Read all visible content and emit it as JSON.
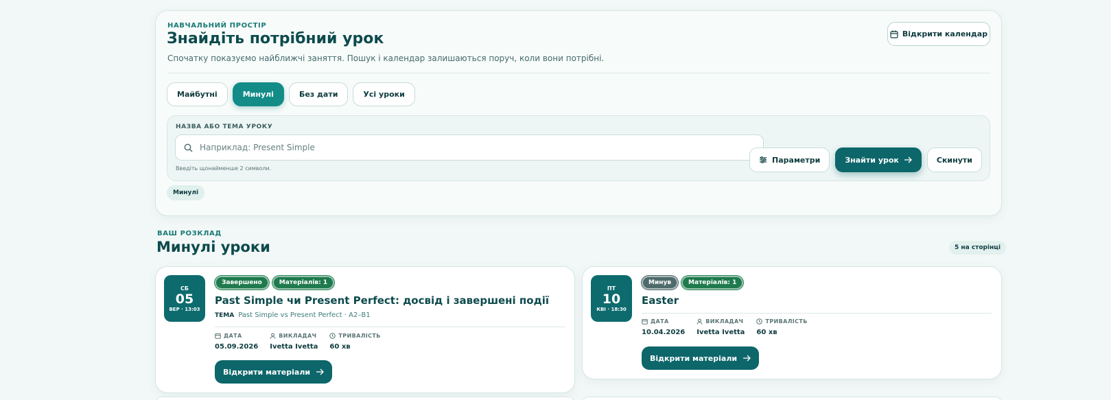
{
  "header": {
    "eyebrow": "НАВЧАЛЬНИЙ ПРОСТІР",
    "title": "Знайдіть потрібний урок",
    "description": "Спочатку показуємо найближчі заняття. Пошук і календар залишаються поруч, коли вони потрібні.",
    "calendar_button": "Відкрити календар"
  },
  "tabs": [
    {
      "label": "Майбутні",
      "active": false
    },
    {
      "label": "Минулі",
      "active": true
    },
    {
      "label": "Без дати",
      "active": false
    },
    {
      "label": "Усі уроки",
      "active": false
    }
  ],
  "search": {
    "label": "НАЗВА АБО ТЕМА УРОКУ",
    "placeholder": "Наприклад: Present Simple",
    "value": "",
    "hint": "Введіть щонайменше 2 символи.",
    "params_button": "Параметри",
    "find_button": "Знайти урок",
    "reset_button": "Скинути"
  },
  "active_filter": "Минулі",
  "section": {
    "eyebrow": "ВАШ РОЗКЛАД",
    "title": "Минулі уроки",
    "per_page": "5 на сторінці"
  },
  "meta_labels": {
    "date": "ДАТА",
    "teacher": "ВИКЛАДАЧ",
    "duration": "ТРИВАЛІСТЬ",
    "topic": "ТЕМА"
  },
  "lessons": [
    {
      "dow": "СБ",
      "day": "05",
      "sub": "ВЕР · 13:03",
      "status": "Завершено",
      "materials": "Матеріалів: 1",
      "title": "Past Simple чи Present Perfect: досвід і завершені події",
      "topic": "Past Simple vs Present Perfect · A2–B1",
      "date": "05.09.2026",
      "teacher": "Ivetta Ivetta",
      "duration": "60 хв",
      "open_button": "Відкрити матеріали"
    },
    {
      "dow": "ПТ",
      "day": "10",
      "sub": "КВІ · 18:30",
      "status": "Минув",
      "materials": "Матеріалів: 1",
      "title": "Easter",
      "date": "10.04.2026",
      "teacher": "Ivetta Ivetta",
      "duration": "60 хв",
      "open_button": "Відкрити матеріали"
    }
  ],
  "colors": {
    "primary": "#0d666a",
    "accent": "#138c88",
    "success": "#1f7a4d",
    "muted_badge": "#4f6a6b",
    "background": "#f2f8f7"
  }
}
